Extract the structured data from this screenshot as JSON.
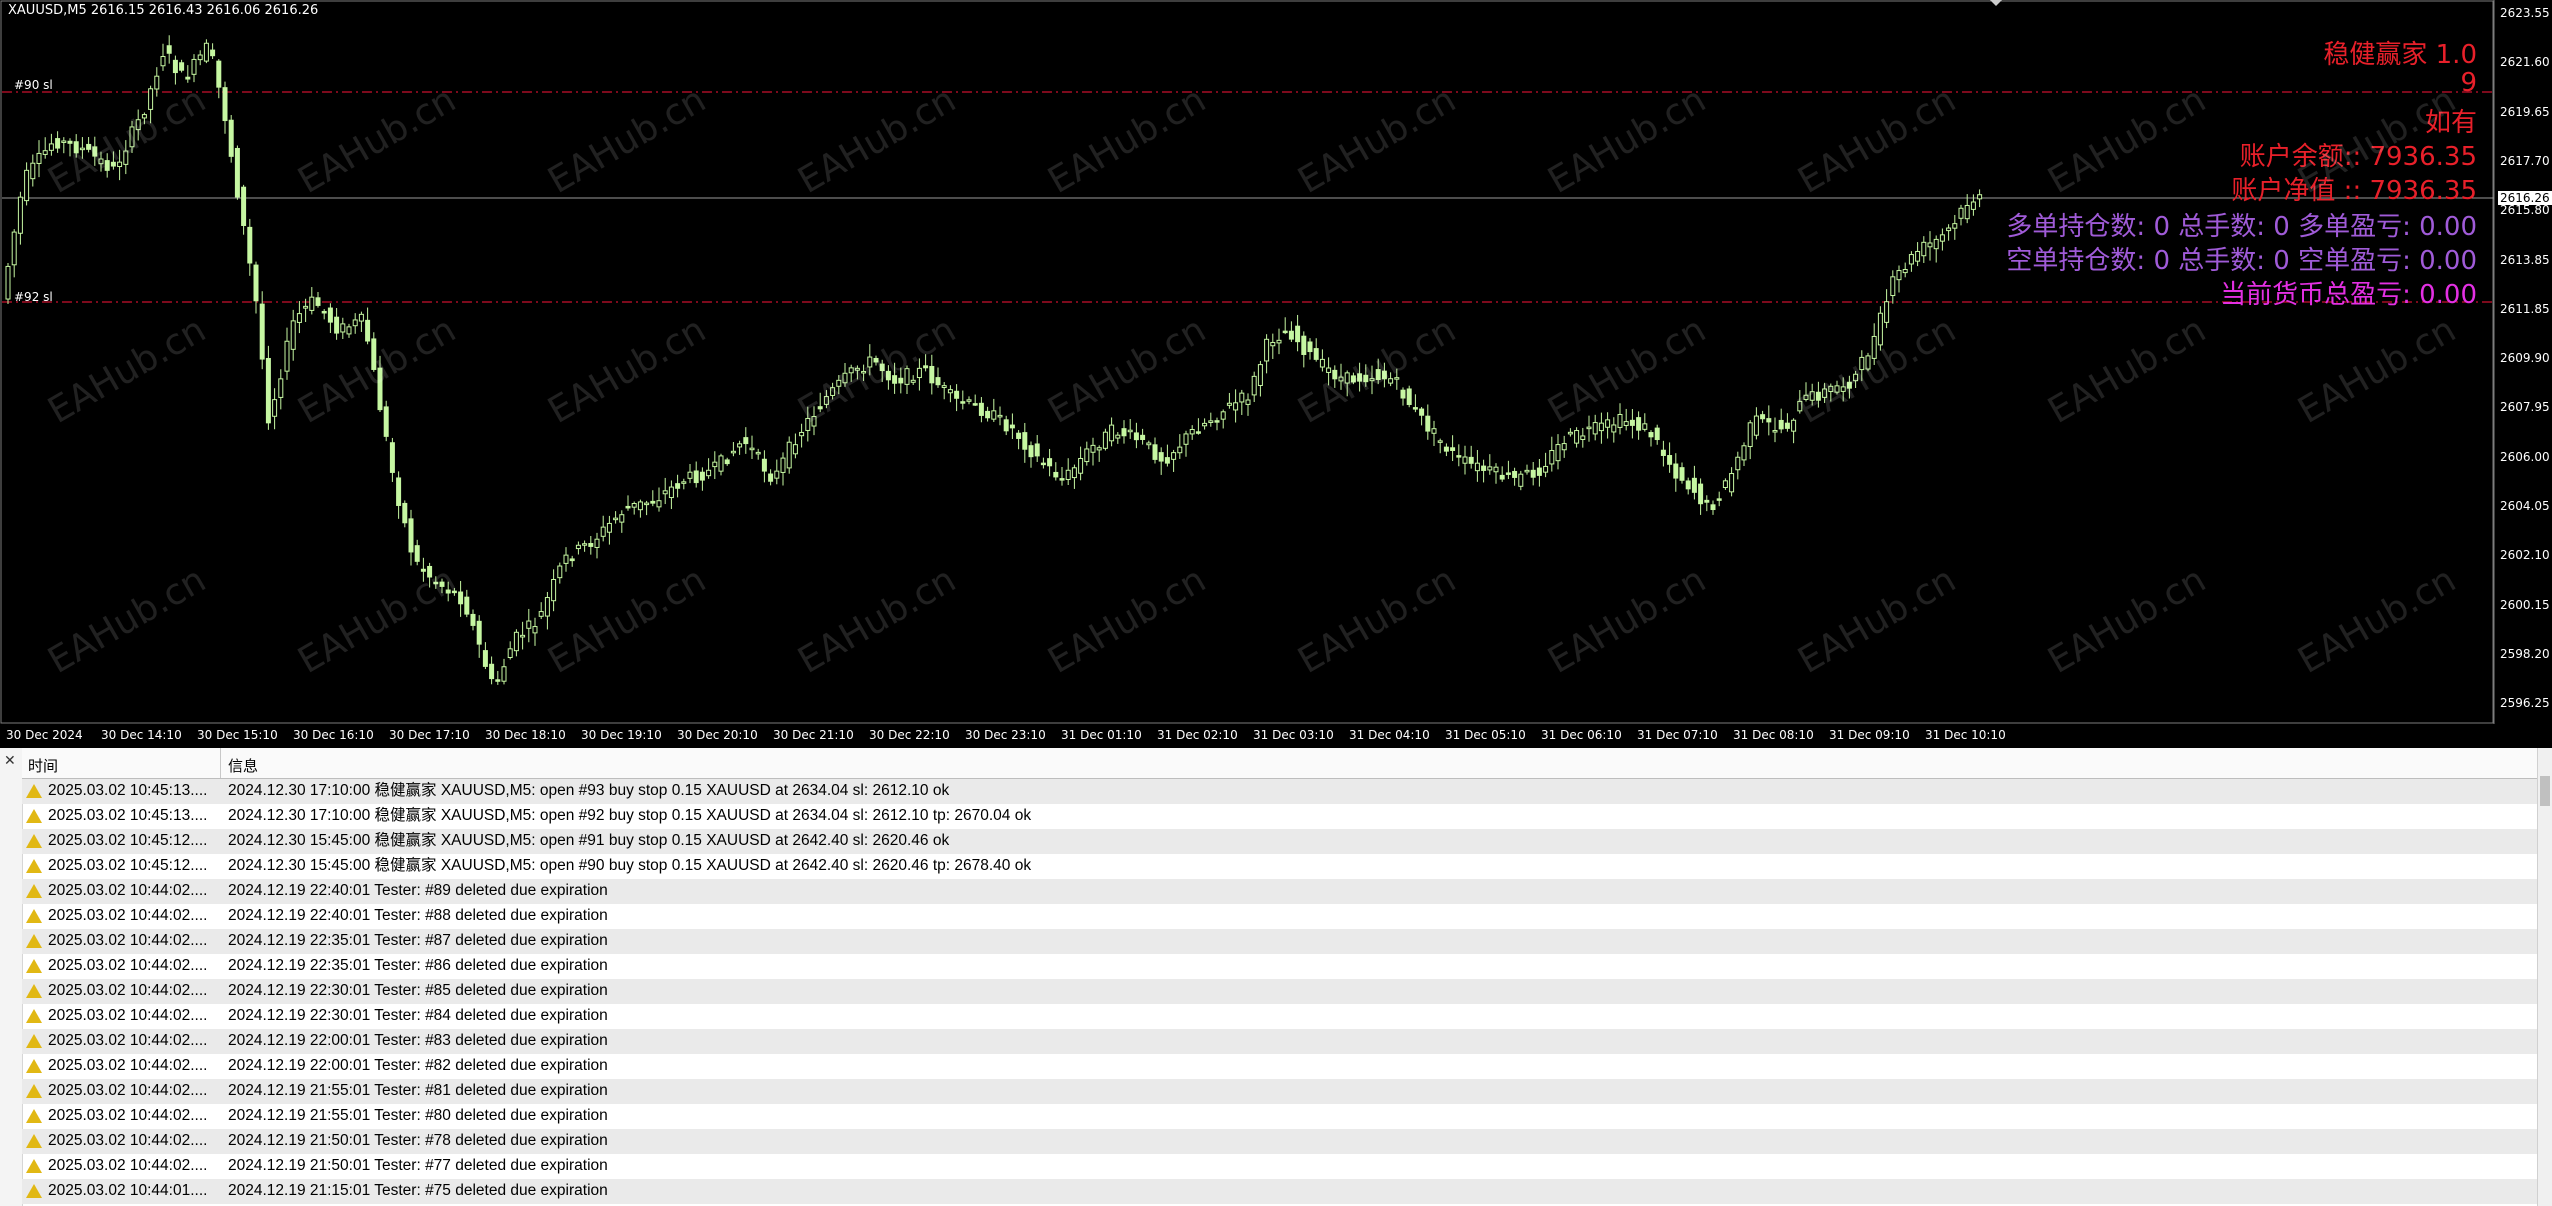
{
  "chart": {
    "ohlc_text": "XAUUSD,M5  2616.15 2616.43 2616.06 2616.26",
    "sl_labels": [
      "#90 sl",
      "#92 sl"
    ],
    "current_price": "2616.26",
    "price_ticks": [
      "2623.55",
      "2621.60",
      "2619.65",
      "2617.70",
      "2615.80",
      "2613.85",
      "2611.85",
      "2609.90",
      "2607.95",
      "2606.00",
      "2604.05",
      "2602.10",
      "2600.15",
      "2598.20",
      "2596.25"
    ],
    "time_ticks": [
      "30 Dec 2024",
      "30 Dec 14:10",
      "30 Dec 15:10",
      "30 Dec 16:10",
      "30 Dec 17:10",
      "30 Dec 18:10",
      "30 Dec 19:10",
      "30 Dec 20:10",
      "30 Dec 21:10",
      "30 Dec 22:10",
      "30 Dec 23:10",
      "31 Dec 01:10",
      "31 Dec 02:10",
      "31 Dec 03:10",
      "31 Dec 04:10",
      "31 Dec 05:10",
      "31 Dec 06:10",
      "31 Dec 07:10",
      "31 Dec 08:10",
      "31 Dec 09:10",
      "31 Dec 10:10"
    ],
    "info_lines": [
      {
        "text": "稳健赢家 1.0",
        "style": "red"
      },
      {
        "text": "9",
        "style": "red"
      },
      {
        "text": "如有",
        "style": "red"
      },
      {
        "text": "账户余额:: 7936.35",
        "style": "red"
      },
      {
        "text": "账户净值 :: 7936.35",
        "style": "red"
      },
      {
        "text": "多单持仓数: 0 总手数: 0 多单盈亏: 0.00",
        "style": "purple"
      },
      {
        "text": "空单持仓数: 0 总手数: 0 空单盈亏: 0.00",
        "style": "purple"
      },
      {
        "text": "当前货币总盈亏: 0.00",
        "style": "magenta"
      }
    ],
    "watermark": "EAHub.cn",
    "colors": {
      "candle": "#c6f7a2",
      "sl_line": "#c8102e",
      "bg": "#000000"
    }
  },
  "terminal": {
    "close_glyph": "✕",
    "columns": {
      "time": "时间",
      "message": "信息"
    },
    "rows": [
      {
        "time": "2025.03.02 10:45:13....",
        "message": "2024.12.30 17:10:00  稳健赢家 XAUUSD,M5: open #93 buy stop 0.15 XAUUSD at 2634.04 sl: 2612.10 ok"
      },
      {
        "time": "2025.03.02 10:45:13....",
        "message": "2024.12.30 17:10:00  稳健赢家 XAUUSD,M5: open #92 buy stop 0.15 XAUUSD at 2634.04 sl: 2612.10 tp: 2670.04 ok"
      },
      {
        "time": "2025.03.02 10:45:12....",
        "message": "2024.12.30 15:45:00  稳健赢家 XAUUSD,M5: open #91 buy stop 0.15 XAUUSD at 2642.40 sl: 2620.46 ok"
      },
      {
        "time": "2025.03.02 10:45:12....",
        "message": "2024.12.30 15:45:00  稳健赢家 XAUUSD,M5: open #90 buy stop 0.15 XAUUSD at 2642.40 sl: 2620.46 tp: 2678.40 ok"
      },
      {
        "time": "2025.03.02 10:44:02....",
        "message": "2024.12.19 22:40:01  Tester: #89 deleted due expiration"
      },
      {
        "time": "2025.03.02 10:44:02....",
        "message": "2024.12.19 22:40:01  Tester: #88 deleted due expiration"
      },
      {
        "time": "2025.03.02 10:44:02....",
        "message": "2024.12.19 22:35:01  Tester: #87 deleted due expiration"
      },
      {
        "time": "2025.03.02 10:44:02....",
        "message": "2024.12.19 22:35:01  Tester: #86 deleted due expiration"
      },
      {
        "time": "2025.03.02 10:44:02....",
        "message": "2024.12.19 22:30:01  Tester: #85 deleted due expiration"
      },
      {
        "time": "2025.03.02 10:44:02....",
        "message": "2024.12.19 22:30:01  Tester: #84 deleted due expiration"
      },
      {
        "time": "2025.03.02 10:44:02....",
        "message": "2024.12.19 22:00:01  Tester: #83 deleted due expiration"
      },
      {
        "time": "2025.03.02 10:44:02....",
        "message": "2024.12.19 22:00:01  Tester: #82 deleted due expiration"
      },
      {
        "time": "2025.03.02 10:44:02....",
        "message": "2024.12.19 21:55:01  Tester: #81 deleted due expiration"
      },
      {
        "time": "2025.03.02 10:44:02....",
        "message": "2024.12.19 21:55:01  Tester: #80 deleted due expiration"
      },
      {
        "time": "2025.03.02 10:44:02....",
        "message": "2024.12.19 21:50:01  Tester: #78 deleted due expiration"
      },
      {
        "time": "2025.03.02 10:44:02....",
        "message": "2024.12.19 21:50:01  Tester: #77 deleted due expiration"
      },
      {
        "time": "2025.03.02 10:44:01....",
        "message": "2024.12.19 21:15:01  Tester: #75 deleted due expiration"
      }
    ]
  }
}
